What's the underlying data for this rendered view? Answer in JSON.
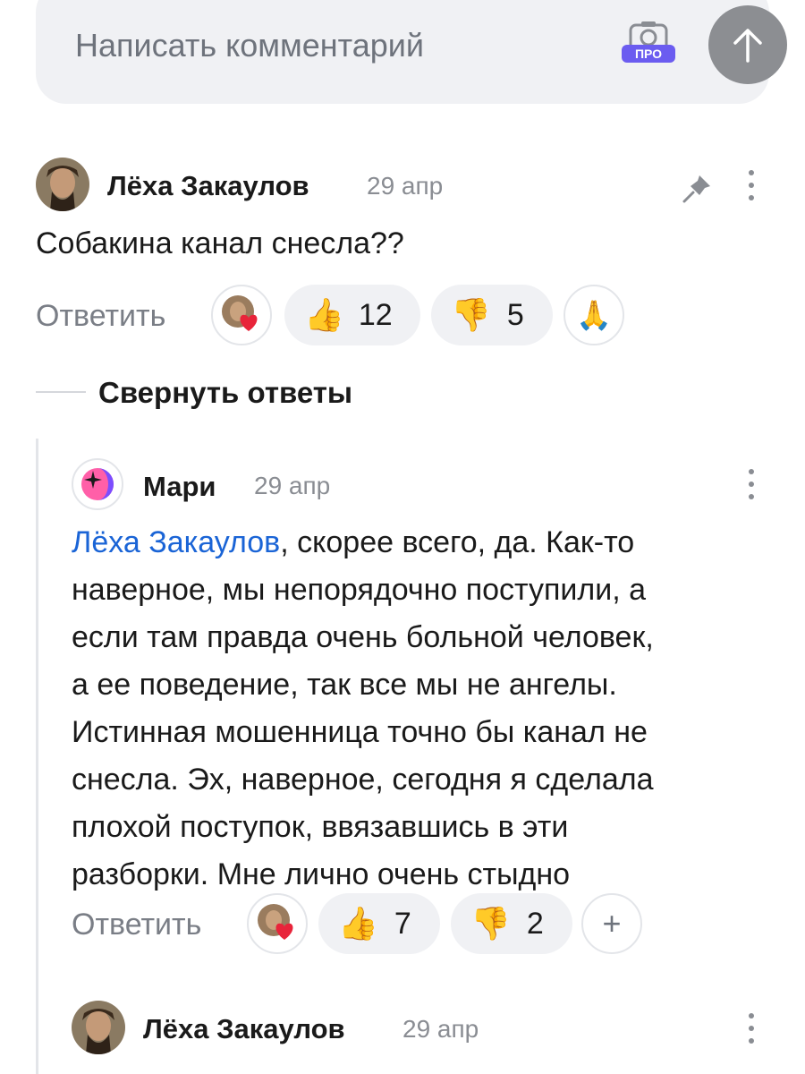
{
  "composer": {
    "placeholder": "Написать комментарий",
    "pro_badge": "ПРО"
  },
  "comment1": {
    "author": "Лёха Закаулов",
    "date": "29 апр",
    "text": "Собакина канал снесла??",
    "reply_label": "Ответить",
    "likes": "12",
    "dislikes": "5"
  },
  "collapse_label": "Свернуть ответы",
  "reply1": {
    "author": "Мари",
    "date": "29 апр",
    "mention": "Лёха Закаулов",
    "lines": [
      ", скорее всего, да. Как-то",
      "наверное, мы непорядочно поступили, а",
      "если там правда очень больной человек,",
      "а ее поведение, так все мы не ангелы.",
      "Истинная мошенница точно бы канал не",
      "снесла. Эх, наверное, сегодня я сделала",
      "плохой поступок, ввязавшись в эти",
      "разборки. Мне лично очень стыдно"
    ],
    "reply_label": "Ответить",
    "likes": "7",
    "dislikes": "2",
    "add_label": "+"
  },
  "reply2": {
    "author": "Лёха Закаулов",
    "date": "29 апр"
  },
  "colors": {
    "mention": "#1a64d6",
    "send": "#8c8e92",
    "pro": "#6b5cf0"
  }
}
